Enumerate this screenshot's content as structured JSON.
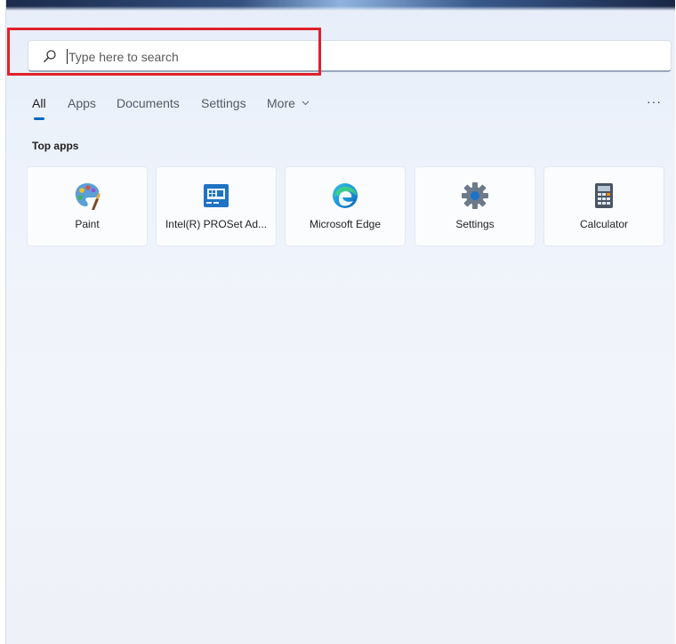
{
  "search": {
    "placeholder": "Type here to search",
    "icon": "search-icon"
  },
  "tabs": [
    {
      "label": "All",
      "active": true
    },
    {
      "label": "Apps"
    },
    {
      "label": "Documents"
    },
    {
      "label": "Settings"
    },
    {
      "label": "More"
    }
  ],
  "more_options_label": "···",
  "top_apps": {
    "title": "Top apps",
    "apps": [
      {
        "label": "Paint",
        "icon": "paint-palette-icon"
      },
      {
        "label": "Intel(R) PROSet Ad...",
        "icon": "intel-proset-icon"
      },
      {
        "label": "Microsoft Edge",
        "icon": "edge-icon"
      },
      {
        "label": "Settings",
        "icon": "gear-icon"
      },
      {
        "label": "Calculator",
        "icon": "calculator-icon"
      }
    ]
  },
  "colors": {
    "accent": "#0067c0",
    "highlight_border": "#e0202a",
    "panel_background": "#eef3fb"
  }
}
